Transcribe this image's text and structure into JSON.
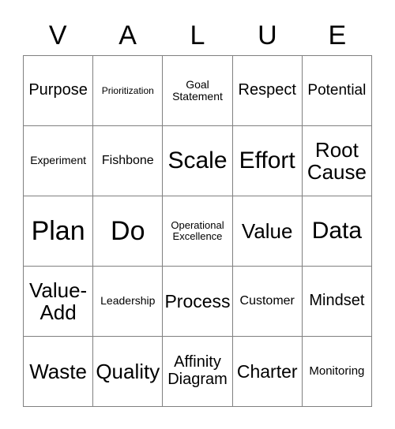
{
  "card": {
    "title_letters": [
      "V",
      "A",
      "L",
      "U",
      "E"
    ],
    "columns": 5,
    "rows": 5,
    "border_color": "#808080",
    "text_color": "#000000",
    "background_color": "#ffffff"
  },
  "cells": [
    {
      "text": "Purpose",
      "size": "fs-lg2",
      "row": 1,
      "col": 1
    },
    {
      "text": "Prioritization",
      "size": "fs-xs",
      "row": 1,
      "col": 2
    },
    {
      "text": "Goal\nStatement",
      "size": "fs-sm2",
      "row": 1,
      "col": 3
    },
    {
      "text": "Respect",
      "size": "fs-lg2",
      "row": 1,
      "col": 4
    },
    {
      "text": "Potential",
      "size": "fs-lg",
      "row": 1,
      "col": 5
    },
    {
      "text": "Experiment",
      "size": "fs-sm2",
      "row": 2,
      "col": 1
    },
    {
      "text": "Fishbone",
      "size": "fs-md2",
      "row": 2,
      "col": 2
    },
    {
      "text": "Scale",
      "size": "fs-huge",
      "row": 2,
      "col": 3
    },
    {
      "text": "Effort",
      "size": "fs-huge",
      "row": 2,
      "col": 4
    },
    {
      "text": "Root\nCause",
      "size": "fs-xxl",
      "row": 2,
      "col": 5
    },
    {
      "text": "Plan",
      "size": "fs-mega",
      "row": 3,
      "col": 1
    },
    {
      "text": "Do",
      "size": "fs-mega",
      "row": 3,
      "col": 2
    },
    {
      "text": "Operational\nExcellence",
      "size": "fs-sm",
      "row": 3,
      "col": 3
    },
    {
      "text": "Value",
      "size": "fs-xxl",
      "row": 3,
      "col": 4
    },
    {
      "text": "Data",
      "size": "fs-huge",
      "row": 3,
      "col": 5
    },
    {
      "text": "Value-\nAdd",
      "size": "fs-xxl",
      "row": 4,
      "col": 1
    },
    {
      "text": "Leadership",
      "size": "fs-sm2",
      "row": 4,
      "col": 2
    },
    {
      "text": "Process",
      "size": "fs-xl",
      "row": 4,
      "col": 3
    },
    {
      "text": "Customer",
      "size": "fs-md2",
      "row": 4,
      "col": 4
    },
    {
      "text": "Mindset",
      "size": "fs-lg2",
      "row": 4,
      "col": 5
    },
    {
      "text": "Waste",
      "size": "fs-xxl",
      "row": 5,
      "col": 1
    },
    {
      "text": "Quality",
      "size": "fs-xxl",
      "row": 5,
      "col": 2
    },
    {
      "text": "Affinity\nDiagram",
      "size": "fs-lg2",
      "row": 5,
      "col": 3
    },
    {
      "text": "Charter",
      "size": "fs-xl",
      "row": 5,
      "col": 4
    },
    {
      "text": "Monitoring",
      "size": "fs-md",
      "row": 5,
      "col": 5
    }
  ]
}
